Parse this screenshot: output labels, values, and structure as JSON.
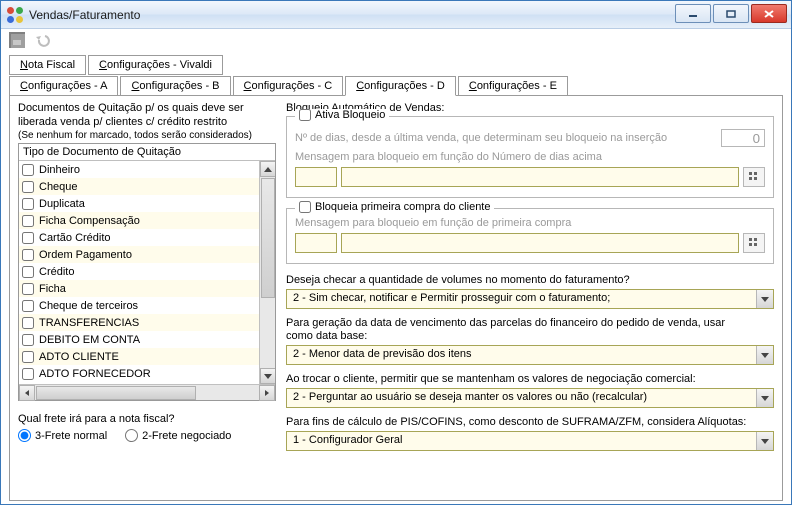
{
  "window": {
    "title": "Vendas/Faturamento"
  },
  "tabs_row1": [
    {
      "label": "Nota Fiscal",
      "underline_first": true
    },
    {
      "label": "Configurações - Vivaldi",
      "underline_first": true
    }
  ],
  "tabs_row2": [
    {
      "label": "Configurações - A",
      "underline_first": true
    },
    {
      "label": "Configurações - B",
      "underline_first": true
    },
    {
      "label": "Configurações - C",
      "underline_first": true
    },
    {
      "label": "Configurações - D",
      "underline_first": true,
      "active": true
    },
    {
      "label": "Configurações - E",
      "underline_first": true
    }
  ],
  "left": {
    "heading_line1": "Documentos de Quitação p/ os quais deve ser",
    "heading_line2": "liberada venda p/ clientes c/ crédito restrito",
    "hint": "(Se nenhum for marcado, todos serão considerados)",
    "list_title": "Tipo de Documento de Quitação",
    "items": [
      "Dinheiro",
      "Cheque",
      "Duplicata",
      "Ficha Compensação",
      "Cartão Crédito",
      "Ordem Pagamento",
      "Crédito",
      "Ficha",
      "Cheque de terceiros",
      "TRANSFERENCIAS",
      "DEBITO EM CONTA",
      "ADTO CLIENTE",
      "ADTO FORNECEDOR"
    ],
    "frete_question": "Qual frete irá para a nota fiscal?",
    "radio1": "3-Frete normal",
    "radio2": "2-Frete negociado"
  },
  "right": {
    "bloqueio_title": "Bloqueio Automático de Vendas:",
    "ativa_bloqueio": "Ativa Bloqueio",
    "dias_label": "Nº de dias, desde a última venda, que determinam seu bloqueio na inserção",
    "dias_value": "0",
    "msg_dias_label": "Mensagem para bloqueio em função do Número de dias acima",
    "bloqueia_primeira": "Bloqueia primeira compra do cliente",
    "msg_primeira_label": "Mensagem para bloqueio em função de primeira compra",
    "q_volumes": "Deseja checar a quantidade de volumes no momento do faturamento?",
    "combo_volumes": "2 - Sim checar, notificar e Permitir prosseguir com o faturamento;",
    "q_vencimento_1": "Para geração da data de vencimento das parcelas do financeiro do pedido de venda, usar",
    "q_vencimento_2": "como data base:",
    "combo_vencimento": "2 - Menor data de previsão dos itens",
    "q_trocar": "Ao trocar o cliente, permitir que se mantenham os valores de negociação comercial:",
    "combo_trocar": "2 - Perguntar ao usuário se deseja manter os valores ou não (recalcular)",
    "q_pis": "Para fins de cálculo de PIS/COFINS, como desconto de SUFRAMA/ZFM, considera Alíquotas:",
    "combo_pis": "1 - Configurador Geral"
  }
}
